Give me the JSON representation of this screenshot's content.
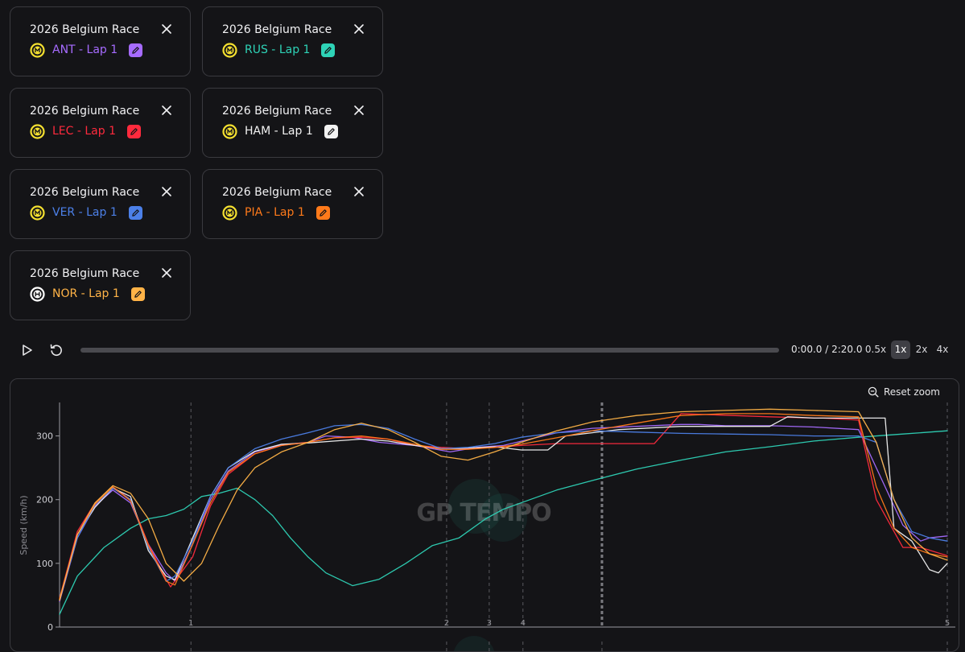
{
  "cards": [
    {
      "title": "2026 Belgium Race",
      "driver_label": "ANT - Lap 1",
      "color": "#a66bff",
      "logo": "mercedes-logo-icon"
    },
    {
      "title": "2026 Belgium Race",
      "driver_label": "RUS - Lap 1",
      "color": "#2ed3b7",
      "logo": "mercedes-logo-icon"
    },
    {
      "title": "2026 Belgium Race",
      "driver_label": "LEC - Lap 1",
      "color": "#ff2a3d",
      "logo": "ferrari-logo-icon"
    },
    {
      "title": "2026 Belgium Race",
      "driver_label": "HAM - Lap 1",
      "color": "#f2f2f2",
      "logo": "ferrari-logo-icon"
    },
    {
      "title": "2026 Belgium Race",
      "driver_label": "VER - Lap 1",
      "color": "#4c80e8",
      "logo": "redbull-logo-icon"
    },
    {
      "title": "2026 Belgium Race",
      "driver_label": "PIA - Lap 1",
      "color": "#ff7a1a",
      "logo": "mclaren-logo-icon"
    },
    {
      "title": "2026 Belgium Race",
      "driver_label": "NOR - Lap 1",
      "color": "#ffb347",
      "logo": "mclaren-logo-icon"
    }
  ],
  "player": {
    "time_readout": "0:00.0 / 2:20.0",
    "progress": 0,
    "speeds": [
      "0.5x",
      "1x",
      "2x",
      "4x"
    ],
    "active_speed": "1x"
  },
  "chart": {
    "reset_zoom_label": "Reset zoom",
    "watermark": "GP TEMPO",
    "accent": "#2ed3b7"
  },
  "chart_data": {
    "type": "line",
    "ylabel": "Speed (km/h)",
    "xlabel": "",
    "ylim": [
      0,
      350
    ],
    "xlim": [
      0,
      1
    ],
    "yticks": [
      0,
      100,
      200,
      300
    ],
    "grid": false,
    "sector_markers": [
      {
        "x": 0.148,
        "label": "1"
      },
      {
        "x": 0.436,
        "label": "2"
      },
      {
        "x": 0.484,
        "label": "3"
      },
      {
        "x": 0.522,
        "label": "4"
      },
      {
        "x": 0.611,
        "label": ""
      },
      {
        "x": 1.0,
        "label": "5"
      }
    ],
    "series": [
      {
        "name": "ANT - Lap 1",
        "color": "#a66bff",
        "x": [
          0,
          0.02,
          0.04,
          0.06,
          0.08,
          0.1,
          0.12,
          0.13,
          0.15,
          0.17,
          0.19,
          0.22,
          0.25,
          0.28,
          0.3,
          0.33,
          0.36,
          0.4,
          0.44,
          0.47,
          0.5,
          0.53,
          0.56,
          0.6,
          0.65,
          0.7,
          0.72,
          0.75,
          0.8,
          0.85,
          0.9,
          0.93,
          0.95,
          0.97,
          0.98,
          1.0
        ],
        "y": [
          40,
          140,
          190,
          215,
          195,
          130,
          85,
          72,
          130,
          200,
          245,
          275,
          286,
          290,
          300,
          298,
          290,
          285,
          275,
          282,
          285,
          295,
          305,
          312,
          315,
          318,
          318,
          316,
          316,
          314,
          310,
          220,
          160,
          135,
          140,
          143
        ]
      },
      {
        "name": "RUS - Lap 1",
        "color": "#2ed3b7",
        "x": [
          0,
          0.02,
          0.05,
          0.08,
          0.1,
          0.12,
          0.14,
          0.16,
          0.18,
          0.2,
          0.22,
          0.24,
          0.26,
          0.28,
          0.3,
          0.33,
          0.36,
          0.39,
          0.42,
          0.45,
          0.48,
          0.5,
          0.53,
          0.56,
          0.6,
          0.65,
          0.7,
          0.75,
          0.8,
          0.85,
          0.9,
          0.95,
          1.0
        ],
        "y": [
          20,
          80,
          125,
          155,
          170,
          175,
          185,
          205,
          210,
          218,
          200,
          175,
          140,
          110,
          85,
          65,
          75,
          100,
          128,
          140,
          170,
          185,
          200,
          215,
          230,
          248,
          262,
          275,
          283,
          292,
          298,
          303,
          308
        ]
      },
      {
        "name": "LEC - Lap 1",
        "color": "#ff2a3d",
        "x": [
          0,
          0.02,
          0.04,
          0.06,
          0.08,
          0.1,
          0.12,
          0.125,
          0.15,
          0.17,
          0.19,
          0.22,
          0.25,
          0.28,
          0.31,
          0.34,
          0.37,
          0.4,
          0.43,
          0.46,
          0.49,
          0.52,
          0.56,
          0.6,
          0.63,
          0.67,
          0.7,
          0.8,
          0.85,
          0.86,
          0.9,
          0.92,
          0.95,
          0.97,
          1.0
        ],
        "y": [
          45,
          150,
          195,
          220,
          200,
          130,
          75,
          63,
          110,
          190,
          240,
          272,
          285,
          290,
          297,
          298,
          295,
          285,
          282,
          280,
          282,
          285,
          288,
          288,
          288,
          288,
          335,
          330,
          328,
          328,
          325,
          200,
          125,
          125,
          112
        ]
      },
      {
        "name": "HAM - Lap 1",
        "color": "#f2f2f2",
        "x": [
          0,
          0.02,
          0.04,
          0.06,
          0.08,
          0.1,
          0.12,
          0.13,
          0.15,
          0.17,
          0.19,
          0.22,
          0.25,
          0.28,
          0.31,
          0.34,
          0.37,
          0.4,
          0.43,
          0.46,
          0.49,
          0.52,
          0.55,
          0.57,
          0.6,
          0.63,
          0.7,
          0.75,
          0.8,
          0.82,
          0.85,
          0.9,
          0.93,
          0.94,
          0.96,
          0.98,
          0.99,
          1.0
        ],
        "y": [
          42,
          145,
          188,
          218,
          205,
          120,
          80,
          74,
          140,
          205,
          250,
          276,
          287,
          289,
          292,
          295,
          292,
          285,
          280,
          281,
          283,
          278,
          278,
          300,
          305,
          310,
          315,
          315,
          315,
          330,
          328,
          328,
          328,
          155,
          135,
          90,
          85,
          100
        ]
      },
      {
        "name": "VER - Lap 1",
        "color": "#4c80e8",
        "x": [
          0,
          0.02,
          0.04,
          0.06,
          0.08,
          0.1,
          0.12,
          0.13,
          0.15,
          0.17,
          0.19,
          0.22,
          0.25,
          0.28,
          0.31,
          0.34,
          0.37,
          0.4,
          0.43,
          0.46,
          0.49,
          0.52,
          0.56,
          0.6,
          0.65,
          0.7,
          0.75,
          0.8,
          0.85,
          0.9,
          0.92,
          0.94,
          0.96,
          0.98,
          1.0
        ],
        "y": [
          43,
          140,
          192,
          218,
          200,
          125,
          72,
          80,
          135,
          205,
          250,
          280,
          295,
          305,
          316,
          318,
          312,
          295,
          280,
          282,
          288,
          298,
          305,
          308,
          306,
          304,
          303,
          302,
          300,
          300,
          290,
          200,
          150,
          140,
          135
        ]
      },
      {
        "name": "PIA - Lap 1",
        "color": "#ff7a1a",
        "x": [
          0,
          0.02,
          0.04,
          0.06,
          0.08,
          0.1,
          0.12,
          0.13,
          0.15,
          0.17,
          0.19,
          0.22,
          0.25,
          0.28,
          0.31,
          0.34,
          0.37,
          0.4,
          0.43,
          0.46,
          0.49,
          0.52,
          0.56,
          0.6,
          0.65,
          0.7,
          0.75,
          0.8,
          0.85,
          0.9,
          0.92,
          0.94,
          0.96,
          0.98,
          1.0
        ],
        "y": [
          44,
          145,
          193,
          220,
          198,
          128,
          72,
          66,
          130,
          195,
          243,
          272,
          285,
          290,
          297,
          300,
          295,
          287,
          279,
          279,
          282,
          287,
          297,
          308,
          320,
          332,
          335,
          335,
          332,
          330,
          220,
          155,
          125,
          115,
          110
        ]
      },
      {
        "name": "NOR - Lap 1",
        "color": "#ffb347",
        "x": [
          0,
          0.02,
          0.04,
          0.06,
          0.08,
          0.1,
          0.12,
          0.14,
          0.16,
          0.18,
          0.2,
          0.22,
          0.25,
          0.28,
          0.31,
          0.34,
          0.37,
          0.4,
          0.43,
          0.46,
          0.49,
          0.52,
          0.56,
          0.6,
          0.65,
          0.7,
          0.75,
          0.8,
          0.85,
          0.9,
          0.92,
          0.94,
          0.96,
          0.98,
          1.0
        ],
        "y": [
          42,
          145,
          195,
          222,
          210,
          170,
          100,
          72,
          100,
          160,
          215,
          250,
          275,
          290,
          310,
          320,
          310,
          290,
          268,
          262,
          275,
          290,
          308,
          322,
          332,
          338,
          340,
          342,
          340,
          338,
          290,
          200,
          140,
          115,
          105
        ]
      }
    ]
  }
}
